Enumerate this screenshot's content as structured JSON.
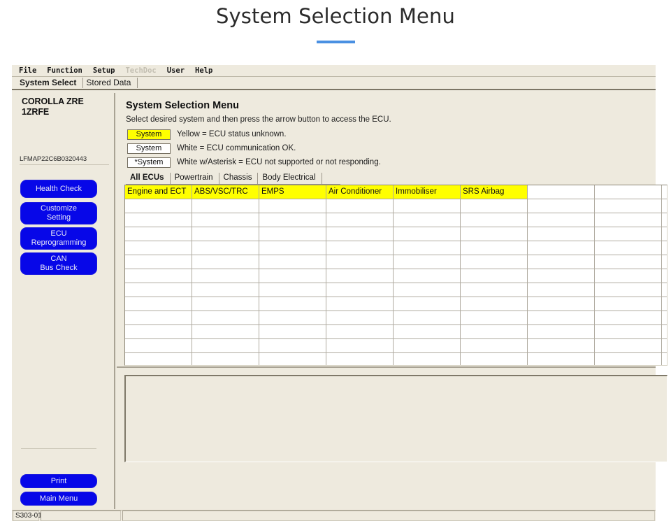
{
  "page": {
    "title": "System Selection Menu",
    "accent_color": "#4a90e2"
  },
  "window": {
    "menu_bar": [
      {
        "label": "File",
        "disabled": false
      },
      {
        "label": "Function",
        "disabled": false
      },
      {
        "label": "Setup",
        "disabled": false
      },
      {
        "label": "TechDoc",
        "disabled": true
      },
      {
        "label": "User",
        "disabled": false
      },
      {
        "label": "Help",
        "disabled": false
      }
    ],
    "tabs": [
      {
        "label": "System Select",
        "active": true
      },
      {
        "label": "Stored Data",
        "active": false
      }
    ]
  },
  "sidebar": {
    "vehicle": "COROLLA ZRE\n1ZRFE",
    "vehicle_line1": "COROLLA ZRE",
    "vehicle_line2": "1ZRFE",
    "vin": "LFMAP22C6B0320443",
    "buttons": [
      {
        "label": "Health Check",
        "line1": "Health Check",
        "line2": ""
      },
      {
        "label": "Customize Setting",
        "line1": "Customize",
        "line2": "Setting"
      },
      {
        "label": "ECU Reprogramming",
        "line1": "ECU",
        "line2": "Reprogramming"
      },
      {
        "label": "CAN Bus Check",
        "line1": "CAN",
        "line2": "Bus Check"
      }
    ],
    "bottom_buttons": [
      {
        "label": "Print"
      },
      {
        "label": "Main Menu"
      }
    ],
    "button_color": "#0707e8"
  },
  "main": {
    "heading": "System Selection Menu",
    "instruction": "Select desired system and then press the arrow button to access the ECU.",
    "legend": [
      {
        "chip": "System",
        "chip_style": "yellow",
        "text": "Yellow = ECU status unknown."
      },
      {
        "chip": "System",
        "chip_style": "white",
        "text": "White = ECU communication OK."
      },
      {
        "chip": "*System",
        "chip_style": "white",
        "text": "White w/Asterisk = ECU not supported or not responding."
      }
    ],
    "legend_colors": {
      "unknown": "#ffff00",
      "ok": "#ffffff"
    },
    "ecu_tabs": [
      {
        "label": "All ECUs",
        "active": true
      },
      {
        "label": "Powertrain",
        "active": false
      },
      {
        "label": "Chassis",
        "active": false
      },
      {
        "label": "Body Electrical",
        "active": false
      }
    ],
    "ecu_grid": {
      "columns": 8,
      "rows": 13,
      "systems": [
        "Engine and ECT",
        "ABS/VSC/TRC",
        "EMPS",
        "Air Conditioner",
        "Immobiliser",
        "SRS Airbag"
      ]
    },
    "output_panel_text": ""
  },
  "status_bar": {
    "code": "S303-01",
    "middle": "",
    "right": ""
  }
}
